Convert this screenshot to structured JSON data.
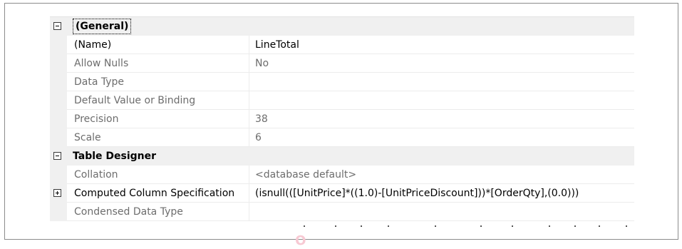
{
  "properties": {
    "general": {
      "title": "(General)",
      "rows": [
        {
          "name": "(Name)",
          "value": "LineTotal",
          "name_dark": true
        },
        {
          "name": "Allow Nulls",
          "value": "No"
        },
        {
          "name": "Data Type",
          "value": ""
        },
        {
          "name": "Default Value or Binding",
          "value": ""
        },
        {
          "name": "Precision",
          "value": "38"
        },
        {
          "name": "Scale",
          "value": "6"
        }
      ]
    },
    "table_designer": {
      "title": "Table Designer",
      "rows": [
        {
          "name": "Collation",
          "value": "<database default>"
        },
        {
          "name": "Computed Column Specification",
          "value": "(isnull(([UnitPrice]*((1.0)-[UnitPriceDiscount]))*[OrderQty],(0.0)))"
        },
        {
          "name": "Condensed Data Type",
          "value": ""
        }
      ]
    }
  },
  "watermark_text": "O"
}
